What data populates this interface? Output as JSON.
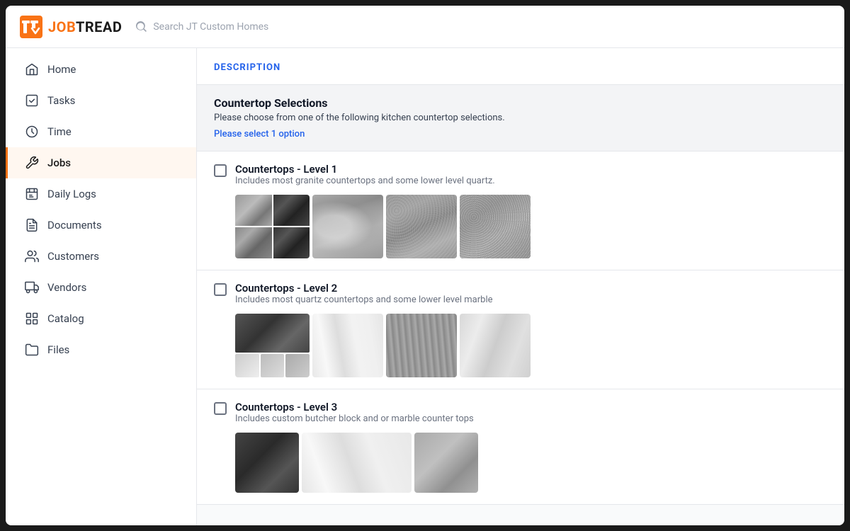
{
  "app": {
    "logo_job": "JOB",
    "logo_tread": "TREAD",
    "search_placeholder": "Search JT Custom Homes"
  },
  "sidebar": {
    "items": [
      {
        "id": "home",
        "label": "Home",
        "active": false
      },
      {
        "id": "tasks",
        "label": "Tasks",
        "active": false
      },
      {
        "id": "time",
        "label": "Time",
        "active": false
      },
      {
        "id": "jobs",
        "label": "Jobs",
        "active": true
      },
      {
        "id": "daily-logs",
        "label": "Daily Logs",
        "active": false
      },
      {
        "id": "documents",
        "label": "Documents",
        "active": false
      },
      {
        "id": "customers",
        "label": "Customers",
        "active": false
      },
      {
        "id": "vendors",
        "label": "Vendors",
        "active": false
      },
      {
        "id": "catalog",
        "label": "Catalog",
        "active": false
      },
      {
        "id": "files",
        "label": "Files",
        "active": false
      }
    ]
  },
  "content": {
    "section_label": "DESCRIPTION",
    "selection_title": "Countertop Selections",
    "selection_subtitle": "Please choose from one of the following kitchen countertop selections.",
    "select_prompt": "Please select 1 option",
    "options": [
      {
        "id": "level1",
        "title": "Countertops - Level 1",
        "description": "Includes most granite countertops and some lower level quartz."
      },
      {
        "id": "level2",
        "title": "Countertops - Level 2",
        "description": "Includes most quartz countertops and some lower level marble"
      },
      {
        "id": "level3",
        "title": "Countertops - Level 3",
        "description": "Includes custom butcher block and or marble counter tops"
      }
    ]
  }
}
